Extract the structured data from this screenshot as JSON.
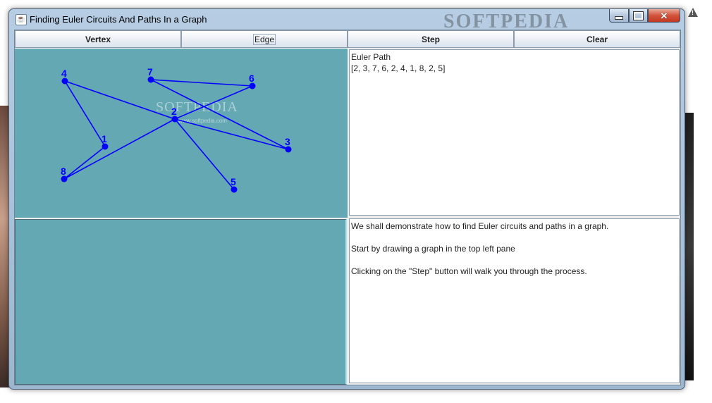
{
  "window": {
    "title": "Finding Euler Circuits And Paths In a Graph",
    "watermark": "SOFTPEDIA"
  },
  "toolbar": {
    "vertex_label": "Vertex",
    "edge_label": "Edge",
    "step_label": "Step",
    "clear_label": "Clear"
  },
  "graph": {
    "watermark": "SOFTPEDIA",
    "watermark_sub": "www.softpedia.com",
    "edge_color": "#0000ff",
    "vertices": [
      {
        "label": "1"
      },
      {
        "label": "2"
      },
      {
        "label": "3"
      },
      {
        "label": "4"
      },
      {
        "label": "5"
      },
      {
        "label": "6"
      },
      {
        "label": "7"
      },
      {
        "label": "8"
      }
    ]
  },
  "result": {
    "heading": "Euler Path",
    "path": "[2, 3, 7, 6, 2, 4, 1, 8, 2, 5]"
  },
  "info": {
    "line1": "We shall demonstrate how to find Euler circuits and paths in a graph.",
    "line2": "Start by drawing a graph in the top left pane",
    "line3": "Clicking on the \"Step\" button will walk you through the process."
  }
}
